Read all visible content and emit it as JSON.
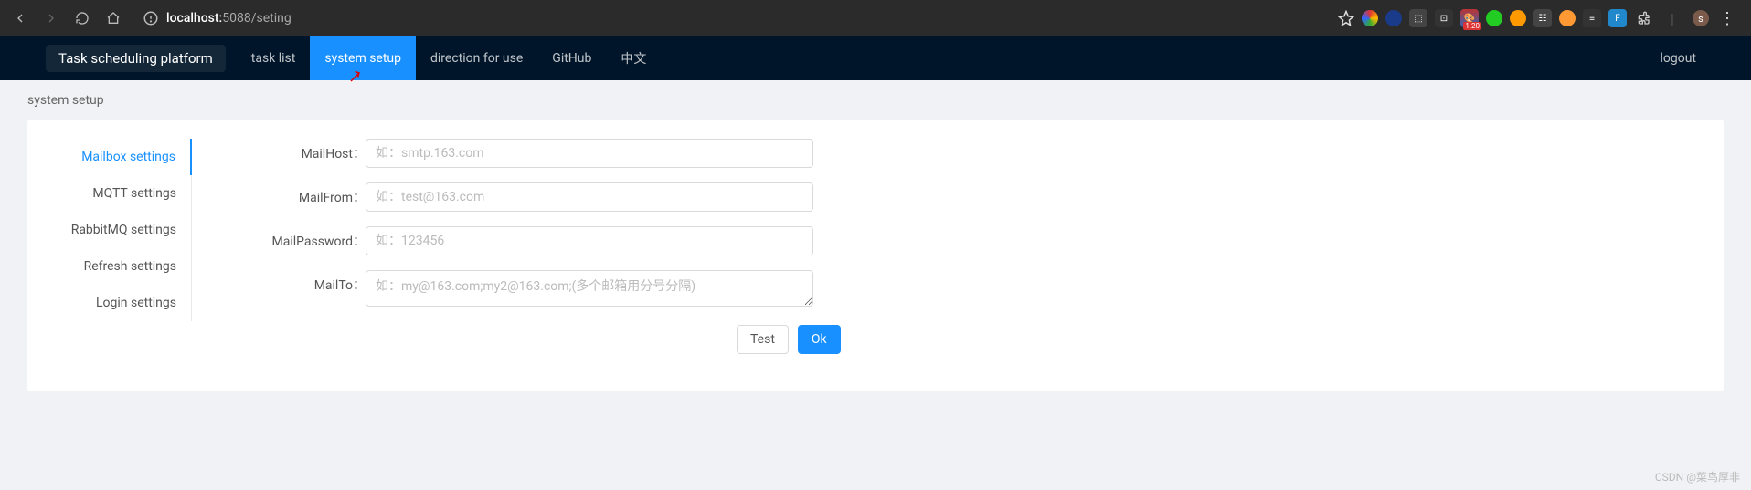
{
  "browser": {
    "url_host": "localhost:",
    "url_port_path": "5088/seting"
  },
  "header": {
    "brand": "Task scheduling platform",
    "tabs": [
      "task list",
      "system setup",
      "direction for use",
      "GitHub",
      "中文"
    ],
    "active_tab_index": 1,
    "logout": "logout"
  },
  "breadcrumb": "system setup",
  "sidebar": {
    "items": [
      "Mailbox settings",
      "MQTT settings",
      "RabbitMQ settings",
      "Refresh settings",
      "Login settings"
    ],
    "active_index": 0
  },
  "form": {
    "fields": [
      {
        "label": "MailHost：",
        "placeholder": "如：smtp.163.com",
        "type": "text",
        "value": ""
      },
      {
        "label": "MailFrom：",
        "placeholder": "如：test@163.com",
        "type": "text",
        "value": ""
      },
      {
        "label": "MailPassword：",
        "placeholder": "如：123456",
        "type": "text",
        "value": ""
      },
      {
        "label": "MailTo：",
        "placeholder": "如：my@163.com;my2@163.com;(多个邮箱用分号分隔)",
        "type": "textarea",
        "value": ""
      }
    ],
    "buttons": {
      "test": "Test",
      "ok": "Ok"
    }
  },
  "watermark": "CSDN @菜鸟厚非",
  "ext_badge": "1.20"
}
